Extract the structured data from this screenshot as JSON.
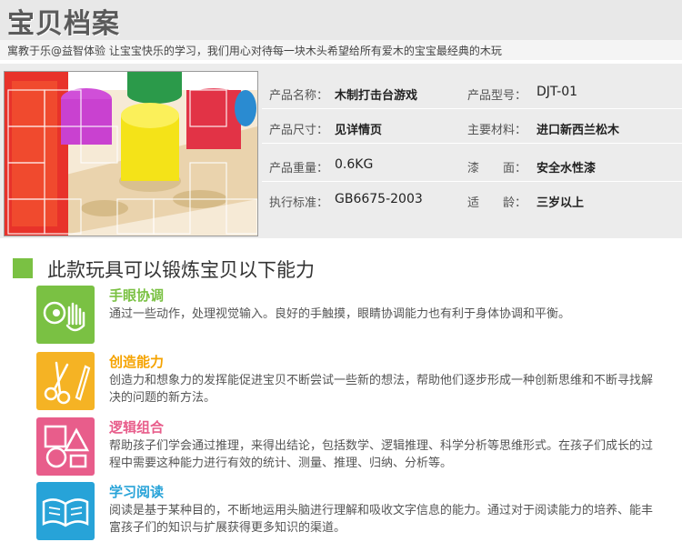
{
  "header": {
    "title": "宝贝档案",
    "subtitle": "寓教于乐@益智体验 让宝宝快乐的学习，我们用心对待每一块木头希望给所有爱木的宝宝最经典的木玩"
  },
  "product": {
    "photo_icon": "wooden-pegs-photo",
    "specs": [
      {
        "label": "产品名称：",
        "value": "木制打击台游戏",
        "label2": "产品型号：",
        "value2": "DJT-01"
      },
      {
        "label": "产品尺寸：",
        "value": "见详情页",
        "label2": "主要材料：",
        "value2": "进口新西兰松木"
      },
      {
        "label": "产品重量：",
        "value": "0.6KG",
        "label2": "漆　　面：",
        "value2": "安全水性漆"
      },
      {
        "label": "执行标准：",
        "value": "GB6675-2003",
        "label2": "适　　龄：",
        "value2": "三岁以上"
      }
    ]
  },
  "abilities": {
    "heading": "此款玩具可以锻炼宝贝以下能力",
    "items": [
      {
        "icon": "eye-hand-icon",
        "title": "手眼协调",
        "color": "#7ac143",
        "desc": "通过一些动作，处理视觉输入。良好的手触摸，眼睛协调能力也有利于身体协调和平衡。"
      },
      {
        "icon": "scissors-pen-icon",
        "title": "创造能力",
        "color": "#f5b324",
        "desc": "创造力和想象力的发挥能促进宝贝不断尝试一些新的想法，帮助他们逐步形成一种创新思维和不断寻找解决的问题的新方法。"
      },
      {
        "icon": "shapes-icon",
        "title": "逻辑组合",
        "color": "#e85d8b",
        "desc": "帮助孩子们学会通过推理，来得出结论，包括数学、逻辑推理、科学分析等思维形式。在孩子们成长的过程中需要这种能力进行有效的统计、测量、推理、归纳、分析等。"
      },
      {
        "icon": "open-book-icon",
        "title": "学习阅读",
        "color": "#27a3d8",
        "desc": "阅读是基于某种目的，不断地运用头脑进行理解和吸收文字信息的能力。通过对于阅读能力的培养、能丰富孩子们的知识与扩展获得更多知识的渠道。"
      }
    ]
  }
}
